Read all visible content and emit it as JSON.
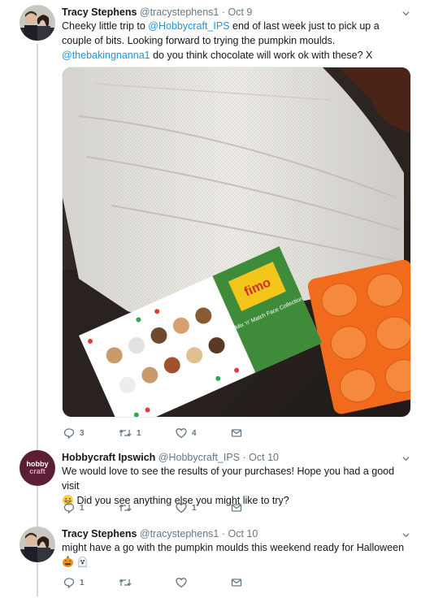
{
  "tweets": [
    {
      "name": "Tracy Stephens",
      "handle": "@tracystephens1",
      "sep": "·",
      "date": "Oct 9",
      "text_1": "Cheeky little trip to ",
      "mention_1": "@Hobbycraft_IPS",
      "text_2": " end of last week just to pick up a couple of bits.  Looking forward to trying the pumpkin moulds.  ",
      "mention_2": "@thebakingnanna1",
      "text_3": " do you think chocolate will work ok with these? X",
      "replies": "3",
      "retweets": "1",
      "likes": "4"
    },
    {
      "name": "Hobbycraft Ipswich",
      "handle": "@Hobbycraft_IPS",
      "sep": "·",
      "date": "Oct 10",
      "avatar_text_1": "hobby",
      "avatar_text_2": "craft",
      "text_1": "We would love to see the results of your purchases! Hope you had a good visit",
      "text_2": " Did you see anything else you might like to try?",
      "replies": "1",
      "retweets": "",
      "likes": "1"
    },
    {
      "name": "Tracy Stephens",
      "handle": "@tracystephens1",
      "sep": "·",
      "date": "Oct 10",
      "text_1": "might have a go with the pumpkin moulds this weekend ready for Halloween",
      "replies": "1",
      "retweets": "",
      "likes": ""
    }
  ],
  "media": {
    "product_label_brand": "fimo",
    "product_label_sub": "Mix 'n' Match Face Collection"
  },
  "colors": {
    "accent": "#1b95e0",
    "meta": "#657786",
    "thread_line": "#cdd9e2",
    "mould": "#f26a1b"
  }
}
